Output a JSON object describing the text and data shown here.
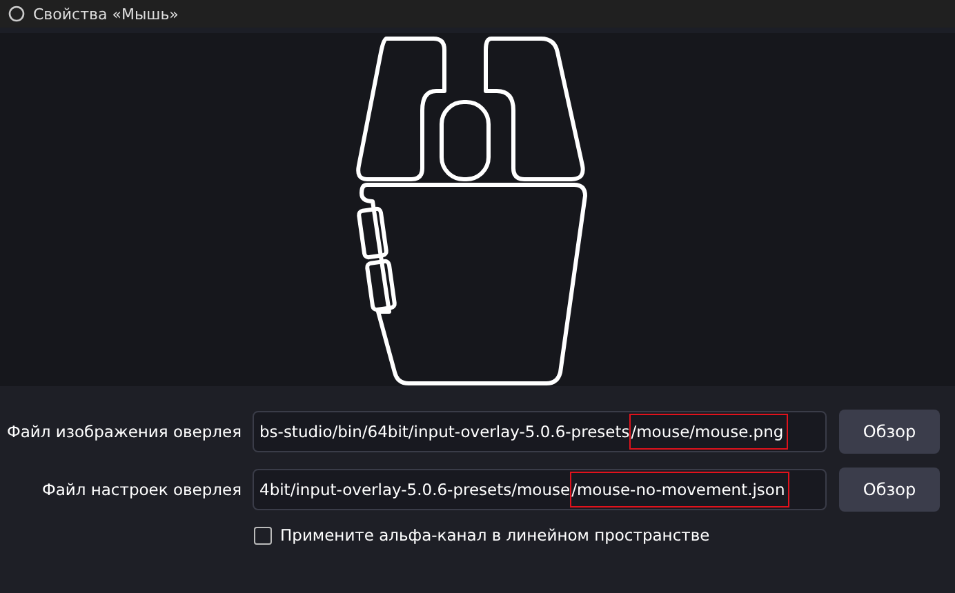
{
  "window": {
    "title": "Свойства «Мышь»"
  },
  "fields": [
    {
      "label": "Файл изображения оверлея",
      "value_parts": [
        {
          "text": "bs-studio/bin/64bit/input-overlay-5.0.6-presets",
          "marked": false
        },
        {
          "text": "/mouse/mouse.png",
          "marked": true
        }
      ],
      "button": "Обзор"
    },
    {
      "label": "Файл настроек оверлея",
      "value_parts": [
        {
          "text": "4bit/input-overlay-5.0.6-presets/mouse",
          "marked": false
        },
        {
          "text": "/mouse-no-movement.json",
          "marked": true
        }
      ],
      "button": "Обзор"
    }
  ],
  "checkbox": {
    "label": "Примените альфа-канал в линейном пространстве",
    "checked": false
  }
}
